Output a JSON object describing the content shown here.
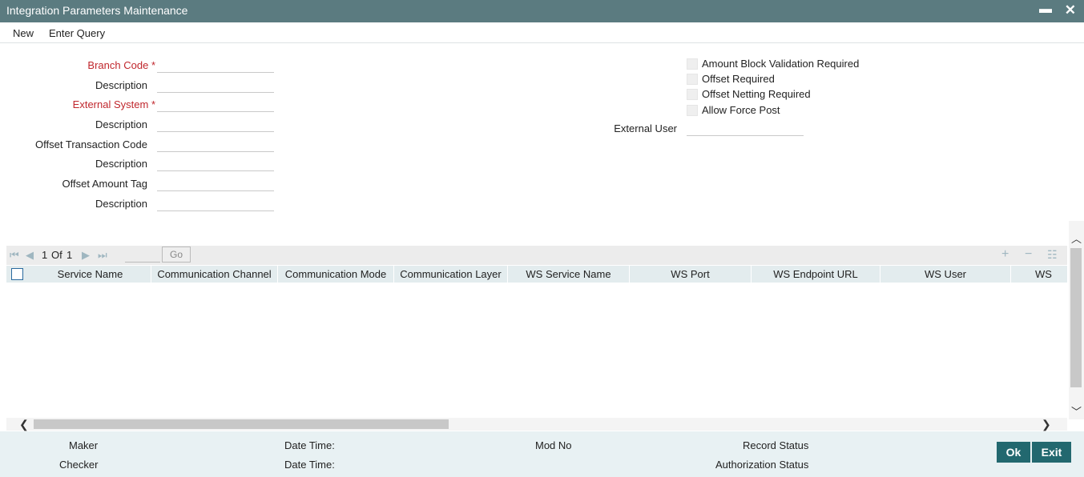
{
  "window": {
    "title": "Integration Parameters Maintenance",
    "minimize_glyph": "▬",
    "close_glyph": "✕"
  },
  "menu": {
    "new": "New",
    "enter_query": "Enter Query"
  },
  "form": {
    "branch_code": {
      "label": "Branch Code",
      "required": "*",
      "value": ""
    },
    "branch_desc": {
      "label": "Description",
      "value": ""
    },
    "external_system": {
      "label": "External System",
      "required": "*",
      "value": ""
    },
    "external_system_desc": {
      "label": "Description",
      "value": ""
    },
    "offset_txn_code": {
      "label": "Offset Transaction Code",
      "value": ""
    },
    "offset_txn_desc": {
      "label": "Description",
      "value": ""
    },
    "offset_amount_tag": {
      "label": "Offset Amount Tag",
      "value": ""
    },
    "offset_amount_desc": {
      "label": "Description",
      "value": ""
    },
    "amount_block_validation": {
      "label": "Amount Block Validation Required",
      "checked": false
    },
    "offset_required": {
      "label": "Offset Required",
      "checked": false
    },
    "offset_netting_required": {
      "label": "Offset Netting Required",
      "checked": false
    },
    "allow_force_post": {
      "label": "Allow Force Post",
      "checked": false
    },
    "external_user": {
      "label": "External User",
      "value": ""
    }
  },
  "grid": {
    "page": "1",
    "of_label": "Of",
    "total_pages": "1",
    "go_label": "Go",
    "columns": [
      "Service Name",
      "Communication Channel",
      "Communication Mode",
      "Communication Layer",
      "WS Service Name",
      "WS Port",
      "WS Endpoint URL",
      "WS User",
      "WS"
    ],
    "rows": []
  },
  "footer": {
    "maker": "Maker",
    "checker": "Checker",
    "date_time_1": "Date Time:",
    "date_time_2": "Date Time:",
    "mod_no": "Mod No",
    "record_status": "Record Status",
    "authorization_status": "Authorization Status",
    "ok": "Ok",
    "exit": "Exit"
  },
  "colors": {
    "titlebar": "#5b7b80",
    "required": "#c0272d",
    "button": "#22686f",
    "footer": "#e8f1f3"
  },
  "icons": [
    "minimize-icon",
    "close-icon",
    "first-page-icon",
    "prev-page-icon",
    "next-page-icon",
    "last-page-icon",
    "add-row-icon",
    "delete-row-icon",
    "single-view-icon",
    "scroll-up-icon",
    "scroll-down-icon",
    "scroll-left-icon",
    "scroll-right-icon"
  ]
}
